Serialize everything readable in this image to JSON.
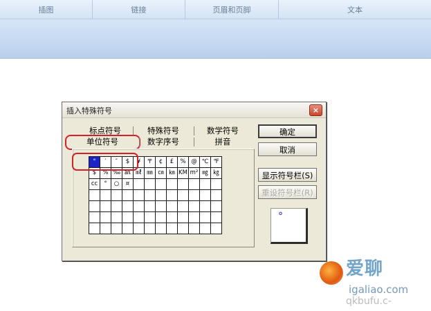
{
  "ribbon": {
    "groups": [
      "插图",
      "链接",
      "页眉和页脚",
      "文本"
    ]
  },
  "dialog": {
    "title": "插入特殊符号",
    "close_icon": "×",
    "tabs_row1": [
      "标点符号",
      "特殊符号",
      "数学符号"
    ],
    "tabs_row2": [
      "单位符号",
      "数字序号",
      "拼音"
    ],
    "active_tab": "单位符号",
    "grid": {
      "rows": [
        [
          "°",
          "′",
          "″",
          "$",
          "¥",
          "〒",
          "¢",
          "£",
          "%",
          "@",
          "℃",
          "℉"
        ],
        [
          "$",
          "%",
          "‰",
          "㏂",
          "㎖",
          "㎜",
          "㎝",
          "㎞",
          "KM",
          "m²",
          "㎎",
          "㎏"
        ],
        [
          "cc",
          "°",
          "○",
          "¤",
          "",
          "",
          "",
          "",
          "",
          "",
          "",
          ""
        ],
        [
          "",
          "",
          "",
          "",
          "",
          "",
          "",
          "",
          "",
          "",
          "",
          ""
        ],
        [
          "",
          "",
          "",
          "",
          "",
          "",
          "",
          "",
          "",
          "",
          "",
          ""
        ],
        [
          "",
          "",
          "",
          "",
          "",
          "",
          "",
          "",
          "",
          "",
          "",
          ""
        ],
        [
          "",
          "",
          "",
          "",
          "",
          "",
          "",
          "",
          "",
          "",
          "",
          ""
        ]
      ],
      "selected": "°"
    },
    "buttons": {
      "ok": "确定",
      "cancel": "取消",
      "show_toolbar": "显示符号栏(S)",
      "reset_toolbar": "重设符号栏(R)"
    },
    "preview_symbol": "°"
  },
  "watermark": {
    "brand": "爱聊",
    "domain": "igaliao.com",
    "sub": "qkbufu.c-"
  },
  "colors": {
    "selection": "#1c24c6",
    "highlight_frame": "#d2202a",
    "dialog_bg": "#ece9d8"
  }
}
